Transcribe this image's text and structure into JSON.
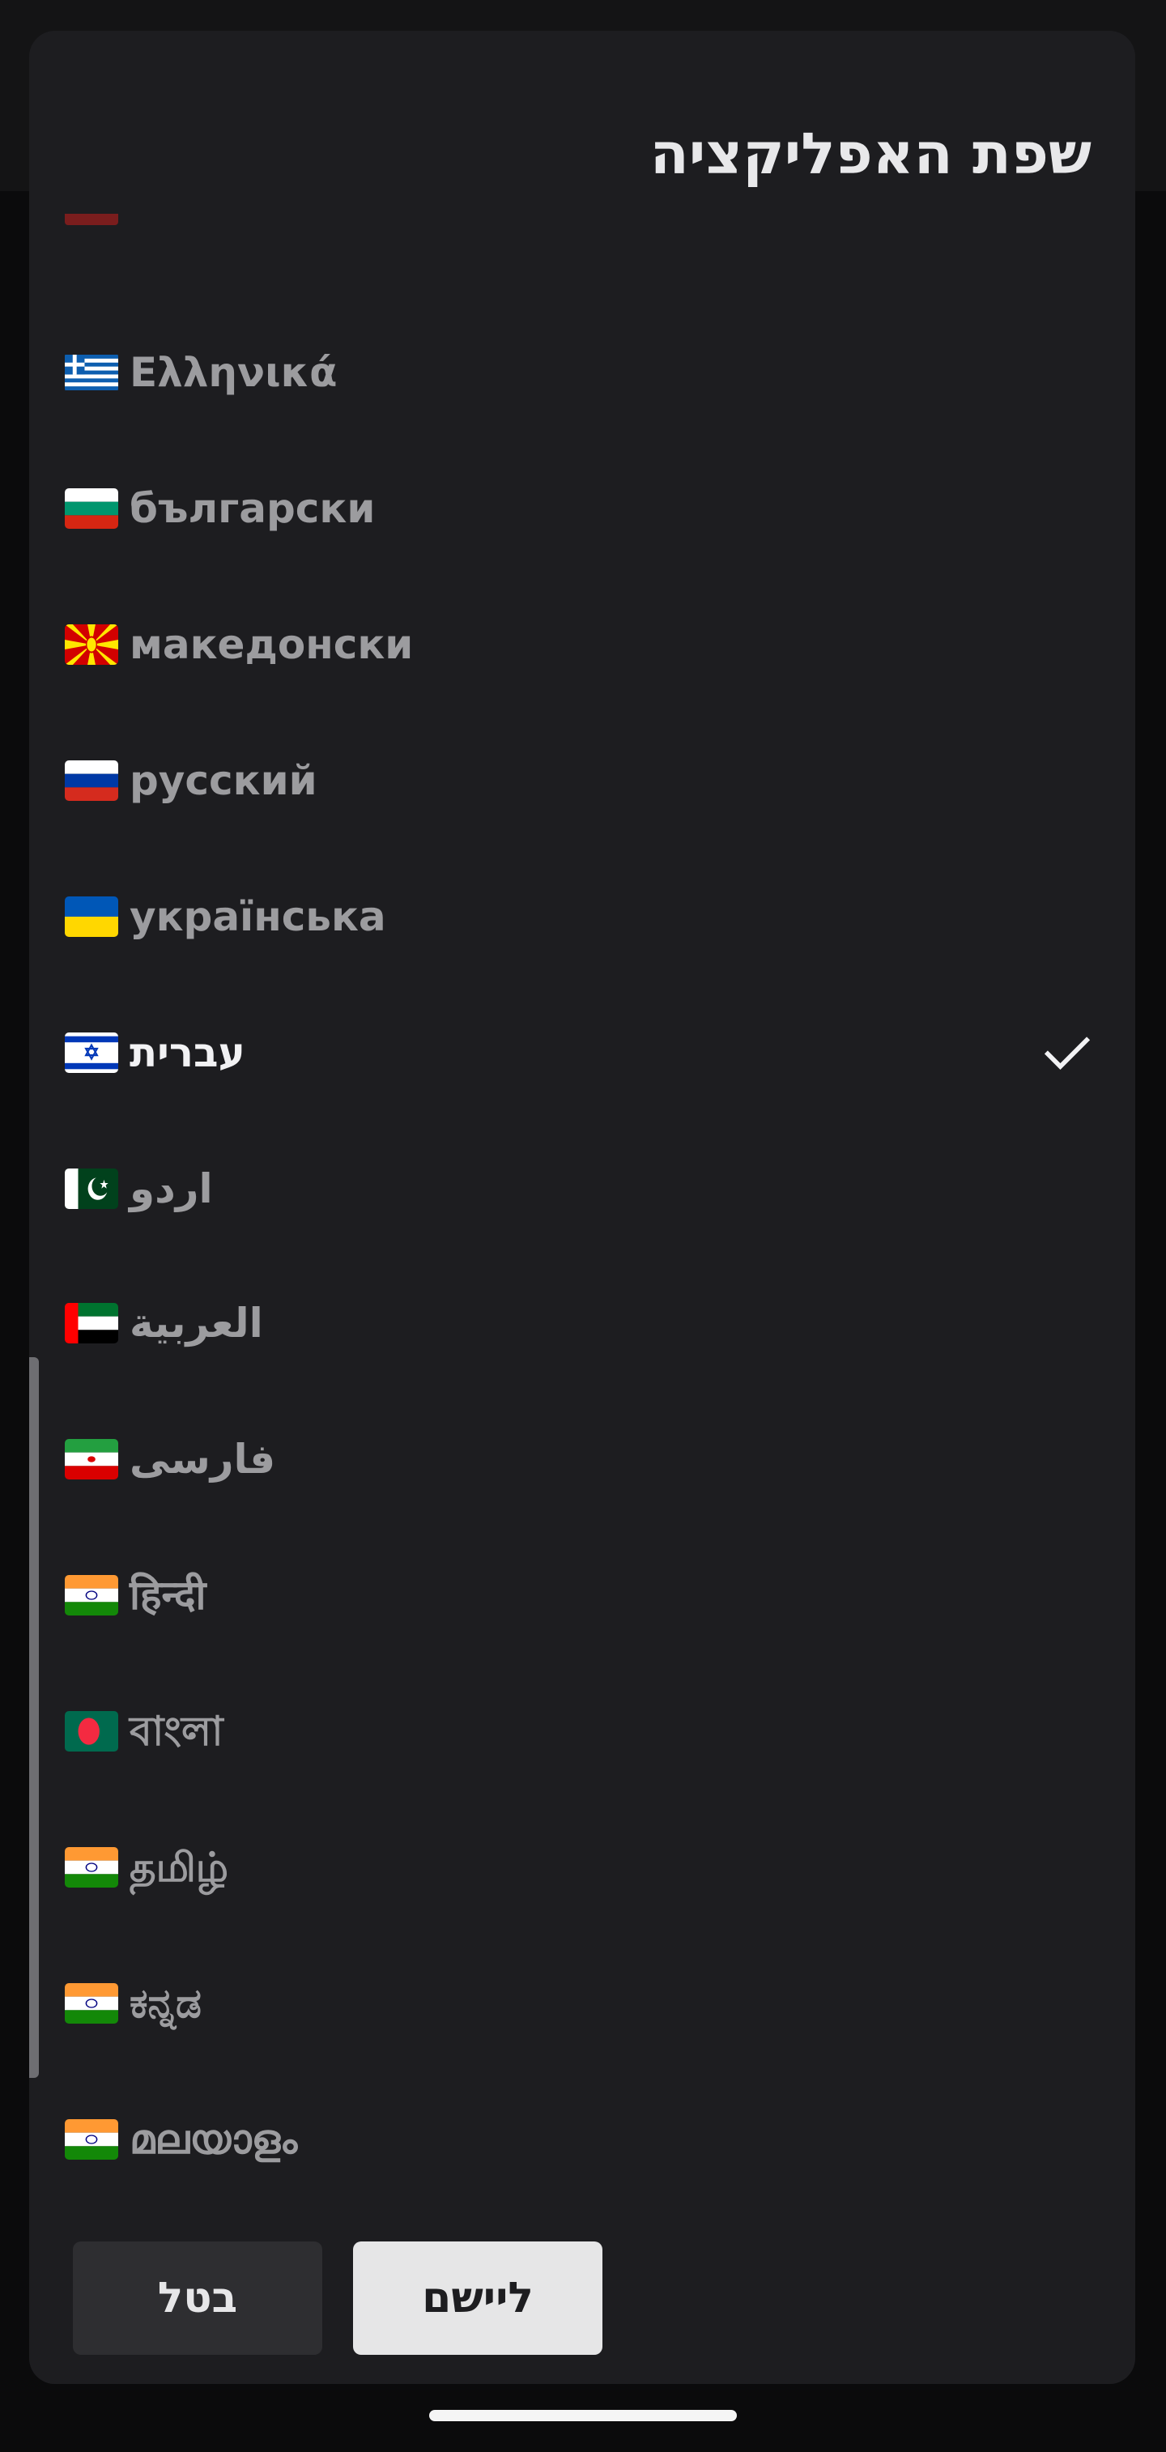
{
  "dialog": {
    "title": "שפת האפליקציה"
  },
  "languages": [
    {
      "label": "Ελληνικά",
      "flag": "greece-flag-icon",
      "selected": false
    },
    {
      "label": "български",
      "flag": "bulgaria-flag-icon",
      "selected": false
    },
    {
      "label": "македонски",
      "flag": "north-macedonia-flag-icon",
      "selected": false
    },
    {
      "label": "русский",
      "flag": "russia-flag-icon",
      "selected": false
    },
    {
      "label": "українська",
      "flag": "ukraine-flag-icon",
      "selected": false
    },
    {
      "label": "עברית",
      "flag": "israel-flag-icon",
      "selected": true
    },
    {
      "label": "اردو",
      "flag": "pakistan-flag-icon",
      "selected": false
    },
    {
      "label": "العربية",
      "flag": "uae-flag-icon",
      "selected": false
    },
    {
      "label": "فارسی",
      "flag": "iran-flag-icon",
      "selected": false
    },
    {
      "label": "हिन्दी",
      "flag": "india-flag-icon",
      "selected": false
    },
    {
      "label": "বাংলা",
      "flag": "bangladesh-flag-icon",
      "selected": false
    },
    {
      "label": "தமிழ்",
      "flag": "india-flag-icon",
      "selected": false
    },
    {
      "label": "ಕನ್ನಡ",
      "flag": "india-flag-icon",
      "selected": false
    },
    {
      "label": "മലയാളം",
      "flag": "india-flag-icon",
      "selected": false
    }
  ],
  "selected_indicator": "checkmark-icon",
  "buttons": {
    "cancel": "בטל",
    "apply": "ליישם"
  },
  "colors": {
    "dialog_background": "#1d1d20",
    "selected_text": "#f2f2f4",
    "unselected_text": "#9c9c9f",
    "apply_button": "#e6e6e7",
    "cancel_button": "#2e2e31"
  }
}
